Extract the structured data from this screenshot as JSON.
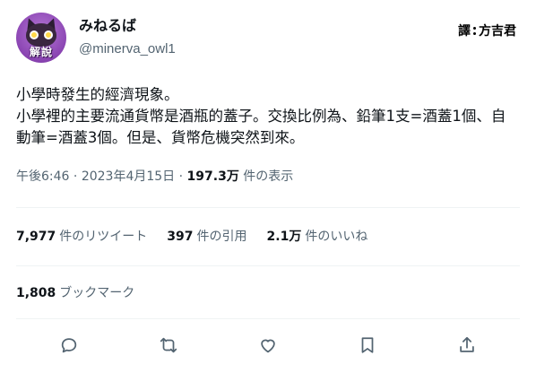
{
  "author": {
    "display_name": "みねるば",
    "handle": "@minerva_owl1",
    "avatar_text": "解說"
  },
  "translator": {
    "prefix": "譯",
    "name": "方吉君"
  },
  "tweet": {
    "text": "小學時發生的經濟現象。\n小學裡的主要流通貨幣是酒瓶的蓋子。交換比例為、鉛筆1支=酒蓋1個、自動筆=酒蓋3個。但是、貨幣危機突然到來。"
  },
  "meta": {
    "time": "午後6:46",
    "separator1": "·",
    "date": "2023年4月15日",
    "separator2": "·",
    "views_count": "197.3万",
    "views_label": "件の表示"
  },
  "stats": {
    "retweets_count": "7,977",
    "retweets_label": "件のリツイート",
    "quotes_count": "397",
    "quotes_label": "件の引用",
    "likes_count": "2.1万",
    "likes_label": "件のいいね"
  },
  "bookmarks": {
    "count": "1,808",
    "label": "ブックマーク"
  },
  "actions": [
    "reply-icon",
    "retweet-icon",
    "like-icon",
    "bookmark-icon",
    "share-icon"
  ],
  "colors": {
    "text": "#0f1419",
    "secondary": "#536471",
    "divider": "#eff3f4",
    "avatar_purple": "#8a44b2"
  }
}
